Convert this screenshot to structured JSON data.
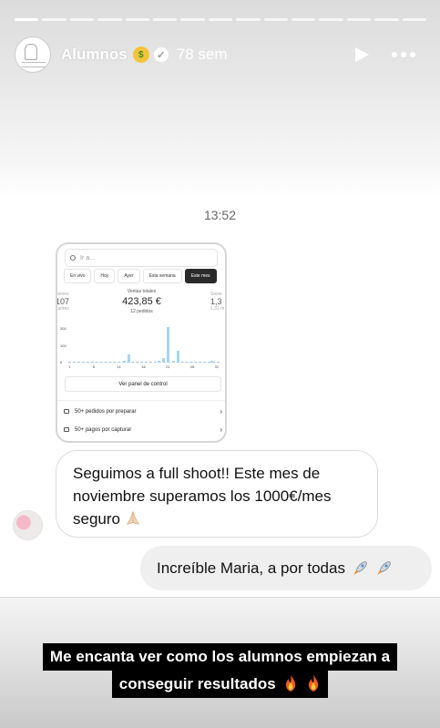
{
  "story": {
    "segments": 15,
    "active_segment": 0,
    "username": "Alumnos",
    "time_ago": "78 sem"
  },
  "chat": {
    "time": "13:52",
    "incoming_message": "Seguimos a full shoot!! Este mes de noviembre superamos los 1000€/mes seguro",
    "outgoing_message": "Increíble Maria, a por todas"
  },
  "screenshot": {
    "search_placeholder": "Ir a...",
    "tabs": [
      "En vivo",
      "Hoy",
      "Ayer",
      "Esta semana",
      "Este mes"
    ],
    "active_tab": "Este mes",
    "left_partial": {
      "label": "siones",
      "value": "107",
      "sub": "itantes"
    },
    "right_partial": {
      "label": "Sesio",
      "value": "1,3",
      "sub": "1,31 m"
    },
    "total_label": "Ventas totales",
    "total_value": "423,85 €",
    "orders": "12 pedidos",
    "y_ticks": [
      "200",
      "100",
      "0"
    ],
    "x_ticks": [
      "1",
      "6",
      "11",
      "16",
      "21",
      "26",
      "31"
    ],
    "panel_button": "Ver panel de control",
    "rows": [
      "50+ pedidos por preparar",
      "50+ pagos por capturar"
    ]
  },
  "chart_data": {
    "type": "bar",
    "x": [
      1,
      2,
      3,
      4,
      5,
      6,
      7,
      8,
      9,
      10,
      11,
      12,
      13,
      14,
      15,
      16,
      17,
      18,
      19,
      20,
      21,
      22,
      23,
      24,
      25,
      26,
      27,
      28,
      29,
      30,
      31
    ],
    "values": [
      0,
      0,
      0,
      0,
      0,
      0,
      0,
      0,
      0,
      0,
      0,
      12,
      45,
      0,
      0,
      0,
      0,
      0,
      10,
      25,
      195,
      10,
      65,
      0,
      0,
      0,
      0,
      0,
      0,
      12,
      0
    ],
    "ylim": [
      0,
      200
    ],
    "y_ticks": [
      0,
      100,
      200
    ],
    "x_ticks": [
      1,
      6,
      11,
      16,
      21,
      26,
      31
    ],
    "color": "#a8d3f4"
  },
  "caption": {
    "line1": "Me encanta ver como los alumnos empiezan a",
    "line2": "conseguir resultados"
  },
  "colors": {
    "bubble_out": "#efefef",
    "caption_bg": "#000000",
    "bar": "#a8d3f4"
  }
}
